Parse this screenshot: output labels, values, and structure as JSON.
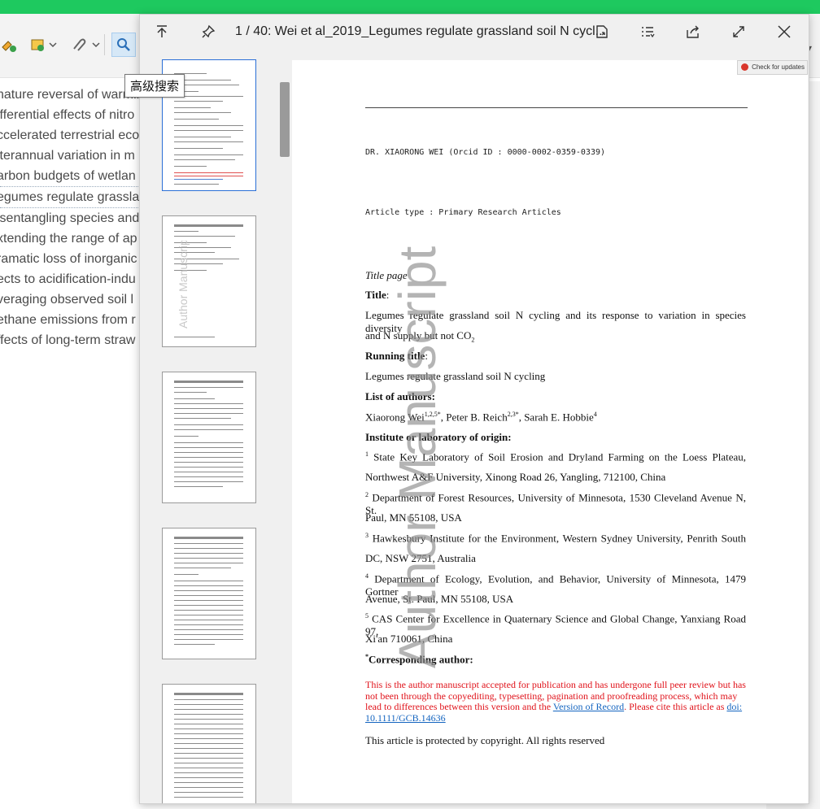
{
  "background": {
    "tooltip": "高级搜索",
    "titles": [
      "nature reversal of warming",
      "ifferential effects of nitro",
      "ccelerated terrestrial eco",
      "iterannual variation in m",
      "arbon budgets of wetlan",
      "egumes regulate grasslar",
      "isentangling species and",
      "xtending the range of ap",
      "ramatic loss of inorganic",
      "ects to acidification-indu",
      "veraging observed soil l",
      "ethane emissions from r",
      "ffects of long-term straw"
    ],
    "selected_index": 5
  },
  "viewer": {
    "title": "1 / 40: Wei et al_2019_Legumes regulate grassland soil N cycl...",
    "check_updates": "Check for updates",
    "watermark": "Author Manuscript",
    "page": {
      "author_header": "DR. XIAORONG  WEI (Orcid ID : 0000-0002-0359-0339)",
      "article_type": "Article type      : Primary Research Articles",
      "title_page": "Title page",
      "title_label": "Title",
      "title_text": "Legumes regulate grassland soil N cycling and its response to variation in species diversity",
      "title_text2": "and N supply but not CO",
      "title_sub": "2",
      "running_label": "Running title",
      "running_text": "Legumes regulate grassland soil N cycling",
      "authors_label": "List of authors:",
      "author1": "Xiaorong Wei",
      "author1_sup": "1,2,5*",
      "author2": ", Peter B. Reich",
      "author2_sup": "2,3*",
      "author3": ", Sarah E. Hobbie",
      "author3_sup": "4",
      "institute_label": "Institute or laboratory of origin:",
      "affil1_num": "1",
      "affil1_line1": " State Key Laboratory of Soil Erosion and Dryland Farming on the Loess Plateau,",
      "affil1_line2": "Northwest A&F University, Xinong Road 26, Yangling, 712100, China",
      "affil2_num": "2",
      "affil2_line1": " Department of Forest Resources, University of Minnesota, 1530 Cleveland Avenue N, St.",
      "affil2_line2": "Paul, MN 55108, USA",
      "affil3_num": "3",
      "affil3_line1": " Hawkesbury Institute for the Environment, Western Sydney University, Penrith South",
      "affil3_line2": "DC, NSW 2751, Australia",
      "affil4_num": "4",
      "affil4_line1": " Department of Ecology, Evolution, and Behavior, University of Minnesota, 1479 Gortner",
      "affil4_line2": "Avenue, St. Paul, MN 55108, USA",
      "affil5_num": "5",
      "affil5_line1": " CAS Center for Excellence in Quaternary Science and Global Change, Yanxiang Road 97,",
      "affil5_line2": "Xi'an 710061, China",
      "corr_sup": "*",
      "corr_label": "Corresponding author:",
      "notice_text": "This is the author manuscript accepted for publication and has undergone full peer review but has not been through the copyediting, typesetting, pagination and proofreading process, which may lead to differences between this version and the ",
      "notice_link1": "Version of Record",
      "notice_mid": ". Please cite this article as ",
      "notice_link2": "doi: 10.1111/GCB.14636",
      "copyright": "This article is protected by copyright. All rights reserved"
    }
  },
  "colors": {
    "accent": "#1ec95f",
    "notice": "#e0131b",
    "link": "#1565c0"
  }
}
